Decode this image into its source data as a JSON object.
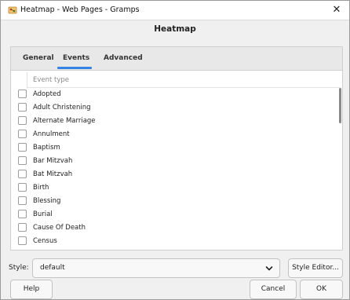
{
  "window": {
    "title": "Heatmap - Web Pages - Gramps"
  },
  "heading": "Heatmap",
  "tabs": [
    {
      "label": "General",
      "active": false
    },
    {
      "label": "Events",
      "active": true
    },
    {
      "label": "Advanced",
      "active": false
    }
  ],
  "event_list": {
    "column_header": "Event type",
    "items": [
      {
        "label": "Adopted",
        "checked": false
      },
      {
        "label": "Adult Christening",
        "checked": false
      },
      {
        "label": "Alternate Marriage",
        "checked": false
      },
      {
        "label": "Annulment",
        "checked": false
      },
      {
        "label": "Baptism",
        "checked": false
      },
      {
        "label": "Bar Mitzvah",
        "checked": false
      },
      {
        "label": "Bat Mitzvah",
        "checked": false
      },
      {
        "label": "Birth",
        "checked": false
      },
      {
        "label": "Blessing",
        "checked": false
      },
      {
        "label": "Burial",
        "checked": false
      },
      {
        "label": "Cause Of Death",
        "checked": false
      },
      {
        "label": "Census",
        "checked": false
      }
    ]
  },
  "style": {
    "label": "Style:",
    "value": "default",
    "editor_button": "Style Editor..."
  },
  "buttons": {
    "help": "Help",
    "cancel": "Cancel",
    "ok": "OK"
  },
  "colors": {
    "accent": "#3584e4"
  }
}
